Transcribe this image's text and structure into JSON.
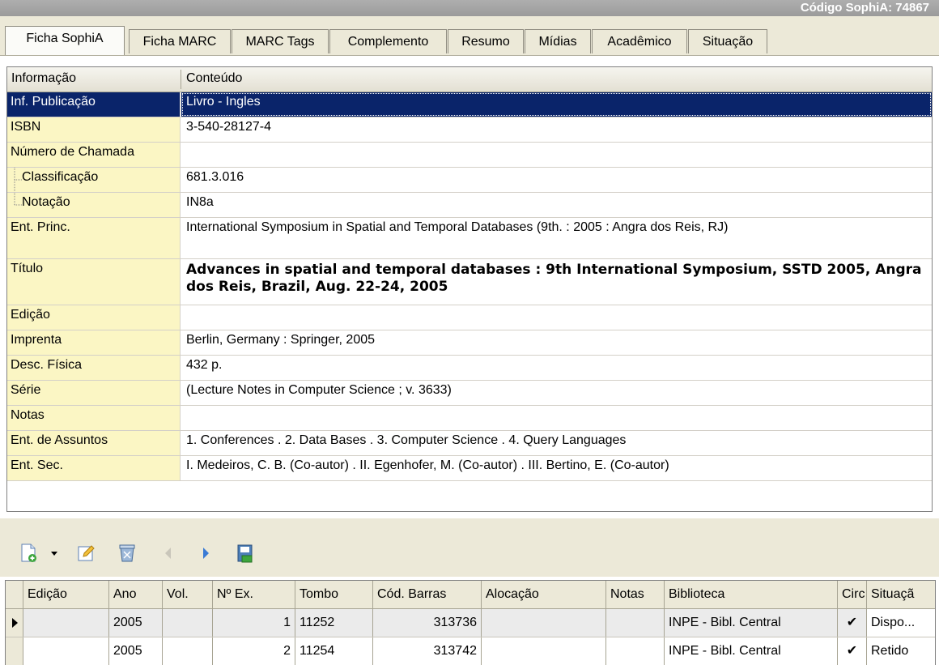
{
  "window": {
    "code_label": "Código SophiA: 74867"
  },
  "tabs": [
    {
      "label": "Ficha SophiA",
      "active": true
    },
    {
      "label": "Ficha MARC"
    },
    {
      "label": "MARC Tags"
    },
    {
      "label": "Complemento"
    },
    {
      "label": "Resumo"
    },
    {
      "label": "Mídias"
    },
    {
      "label": "Acadêmico"
    },
    {
      "label": "Situação"
    }
  ],
  "detail": {
    "header": {
      "info": "Informação",
      "content": "Conteúdo"
    },
    "rows": [
      {
        "label": "Inf. Publicação",
        "value": "Livro - Ingles",
        "selected": true
      },
      {
        "label": "ISBN",
        "value": "3-540-28127-4"
      },
      {
        "label": "Número de Chamada",
        "value": ""
      },
      {
        "label": "Classificação",
        "value": "681.3.016",
        "child": true
      },
      {
        "label": "Notação",
        "value": "IN8a",
        "child": true,
        "last_child": true
      },
      {
        "label": "Ent. Princ.",
        "value": "International Symposium in Spatial and Temporal Databases (9th. : 2005 : Angra dos Reis, RJ)"
      },
      {
        "label": "Título",
        "value": "Advances in spatial and temporal databases : 9th International Symposium, SSTD 2005, Angra dos Reis, Brazil, Aug. 22-24, 2005",
        "bold": true
      },
      {
        "label": "Edição",
        "value": ""
      },
      {
        "label": "Imprenta",
        "value": "Berlin, Germany : Springer, 2005"
      },
      {
        "label": "Desc. Física",
        "value": "432 p."
      },
      {
        "label": "Série",
        "value": "(Lecture Notes in Computer Science ; v. 3633)"
      },
      {
        "label": "Notas",
        "value": ""
      },
      {
        "label": "Ent. de Assuntos",
        "value": "1. Conferences . 2. Data Bases . 3. Computer Science . 4. Query Languages"
      },
      {
        "label": "Ent. Sec.",
        "value": "I. Medeiros, C. B. (Co-autor) . II. Egenhofer, M. (Co-autor) . III. Bertino, E. (Co-autor)"
      }
    ]
  },
  "toolbar": {
    "buttons": [
      {
        "name": "new-document-icon"
      },
      {
        "name": "dropdown-arrow-icon"
      },
      {
        "name": "edit-icon"
      },
      {
        "name": "delete-icon"
      },
      {
        "name": "previous-icon"
      },
      {
        "name": "next-icon"
      },
      {
        "name": "save-icon"
      }
    ]
  },
  "copies": {
    "columns": [
      "Edição",
      "Ano",
      "Vol.",
      "Nº Ex.",
      "Tombo",
      "Cód. Barras",
      "Alocação",
      "Notas",
      "Biblioteca",
      "Circ",
      "Situaçã"
    ],
    "rows": [
      {
        "current": true,
        "edicao": "",
        "ano": "2005",
        "vol": "",
        "nex": "1",
        "tombo": "11252",
        "cod": "313736",
        "alocacao": "",
        "notas": "",
        "biblioteca": "INPE - Bibl. Central",
        "circ": "✔",
        "situacao": "Dispo..."
      },
      {
        "current": false,
        "edicao": "",
        "ano": "2005",
        "vol": "",
        "nex": "2",
        "tombo": "11254",
        "cod": "313742",
        "alocacao": "",
        "notas": "",
        "biblioteca": "INPE - Bibl. Central",
        "circ": "✔",
        "situacao": "Retido"
      }
    ]
  }
}
